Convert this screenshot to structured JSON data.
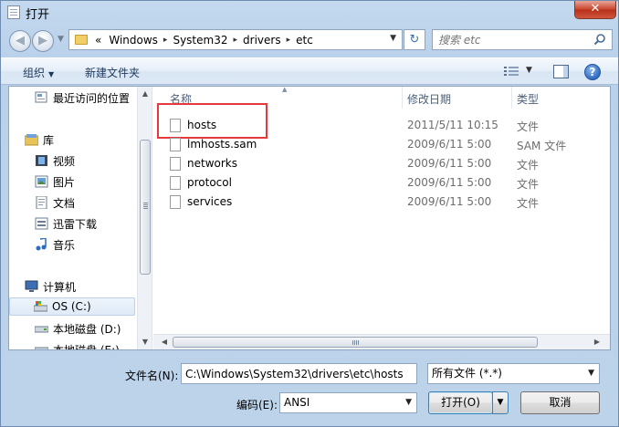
{
  "window": {
    "title": "打开",
    "close_label": "✕"
  },
  "address": {
    "overflow": "«",
    "crumbs": [
      "Windows",
      "System32",
      "drivers",
      "etc"
    ],
    "separator": "▸"
  },
  "search": {
    "placeholder": "搜索 etc"
  },
  "toolbar": {
    "organize_label": "组织",
    "new_folder_label": "新建文件夹",
    "help_label": "?"
  },
  "nav": {
    "items": [
      {
        "label": "最近访问的位置",
        "icon": "recent-places-icon"
      },
      {
        "label": "库",
        "icon": "libraries-icon"
      },
      {
        "label": "视频",
        "icon": "video-icon"
      },
      {
        "label": "图片",
        "icon": "pictures-icon"
      },
      {
        "label": "文档",
        "icon": "documents-icon"
      },
      {
        "label": "迅雷下载",
        "icon": "download-folder-icon"
      },
      {
        "label": "音乐",
        "icon": "music-icon"
      },
      {
        "label": "计算机",
        "icon": "computer-icon"
      },
      {
        "label": "OS (C:)",
        "icon": "os-drive-icon"
      },
      {
        "label": "本地磁盘 (D:)",
        "icon": "disk-drive-icon"
      },
      {
        "label": "本地磁盘 (E:)",
        "icon": "disk-drive-icon"
      }
    ]
  },
  "columns": {
    "name": "名称",
    "date": "修改日期",
    "type": "类型"
  },
  "files": [
    {
      "name": "hosts",
      "date": "2011/5/11 10:15",
      "type": "文件"
    },
    {
      "name": "lmhosts.sam",
      "date": "2009/6/11 5:00",
      "type": "SAM 文件"
    },
    {
      "name": "networks",
      "date": "2009/6/11 5:00",
      "type": "文件"
    },
    {
      "name": "protocol",
      "date": "2009/6/11 5:00",
      "type": "文件"
    },
    {
      "name": "services",
      "date": "2009/6/11 5:00",
      "type": "文件"
    }
  ],
  "bottom": {
    "filename_label": "文件名(N):",
    "filename_value": "C:\\Windows\\System32\\drivers\\etc\\hosts",
    "filetype_value": "所有文件 (*.*)",
    "encoding_label": "编码(E):",
    "encoding_value": "ANSI",
    "open_label": "打开(O)",
    "cancel_label": "取消"
  },
  "colors": {
    "highlight_box": "#e5393c",
    "window_bg": "#bcd3ea"
  }
}
